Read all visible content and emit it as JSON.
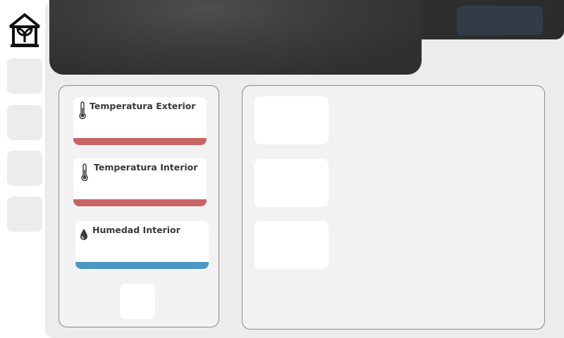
{
  "app": {
    "logo_icon": "greenhouse-plant-icon"
  },
  "sidebar": {
    "buttons": [
      {
        "name": "nav-button-1"
      },
      {
        "name": "nav-button-2"
      },
      {
        "name": "nav-button-3"
      },
      {
        "name": "nav-button-4"
      }
    ]
  },
  "sensors": [
    {
      "title": "Temperatura Exterior",
      "icon": "thermometer-icon",
      "color": "#c86464"
    },
    {
      "title": "Temperatura Interior",
      "icon": "thermometer-icon",
      "color": "#c86464"
    },
    {
      "title": "Humedad Interior",
      "icon": "droplet-icon",
      "color": "#4b98c4"
    }
  ],
  "colors": {
    "header_dark": "#2f2f2f",
    "header_button": "#323c46",
    "panel_bg": "#f3f2f3",
    "background": "#ececec"
  }
}
